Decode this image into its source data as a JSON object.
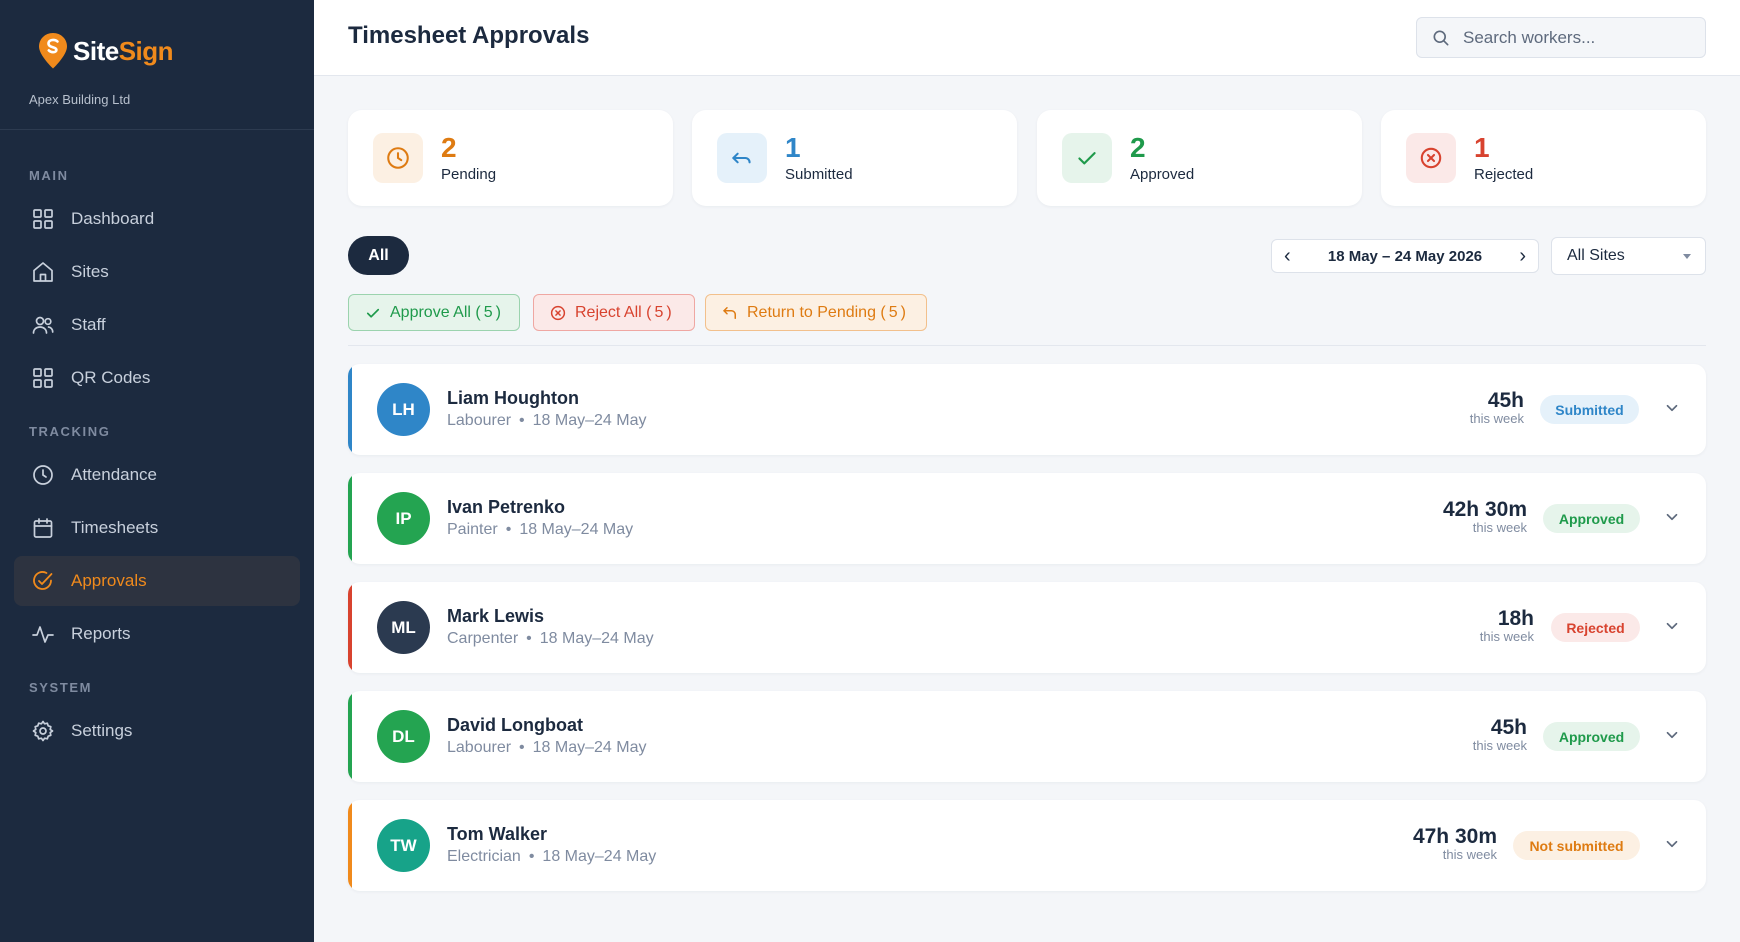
{
  "sidebar": {
    "logo": {
      "word1": "Site",
      "word2": "Sign"
    },
    "company": "Apex Building Ltd",
    "sections": {
      "main": "MAIN",
      "tracking": "TRACKING",
      "system": "SYSTEM"
    },
    "items": [
      {
        "label": "Dashboard",
        "icon": "grid-icon"
      },
      {
        "label": "Sites",
        "icon": "home-icon"
      },
      {
        "label": "Staff",
        "icon": "users-icon"
      },
      {
        "label": "QR Codes",
        "icon": "qr-icon"
      },
      {
        "label": "Attendance",
        "icon": "clock-icon"
      },
      {
        "label": "Timesheets",
        "icon": "calendar-icon"
      },
      {
        "label": "Approvals",
        "icon": "check-circle-icon",
        "active": true
      },
      {
        "label": "Reports",
        "icon": "activity-icon"
      },
      {
        "label": "Settings",
        "icon": "gear-icon"
      }
    ]
  },
  "header": {
    "title": "Timesheet Approvals",
    "search_placeholder": "Search workers..."
  },
  "stats": [
    {
      "value": "2",
      "label": "Pending",
      "color": "#de7b12",
      "icon": "clock-icon"
    },
    {
      "value": "1",
      "label": "Submitted",
      "color": "#2f86c8",
      "icon": "return-icon"
    },
    {
      "value": "2",
      "label": "Approved",
      "color": "#1f9a4b",
      "icon": "check-icon"
    },
    {
      "value": "1",
      "label": "Rejected",
      "color": "#d8432f",
      "icon": "x-circle-icon"
    }
  ],
  "filters": {
    "tab_all": "All",
    "week_range": "18 May – 24 May 2026",
    "site": "All Sites"
  },
  "bulk_actions": {
    "approve_label": "Approve All (",
    "reject_label": "Reject All (",
    "return_label": "Return to Pending (",
    "count": "5",
    "close": ")"
  },
  "workers": [
    {
      "initials": "LH",
      "name": "Liam Houghton",
      "role": "Labourer",
      "period": "18 May–24 May",
      "hours": "45h",
      "hours_note": "this week",
      "status": "Submitted",
      "avatar_color": "#2f86c8",
      "accent": "#2f86c8"
    },
    {
      "initials": "IP",
      "name": "Ivan Petrenko",
      "role": "Painter",
      "period": "18 May–24 May",
      "hours": "42h 30m",
      "hours_note": "this week",
      "status": "Approved",
      "avatar_color": "#24a451",
      "accent": "#24a451"
    },
    {
      "initials": "ML",
      "name": "Mark Lewis",
      "role": "Carpenter",
      "period": "18 May–24 May",
      "hours": "18h",
      "hours_note": "this week",
      "status": "Rejected",
      "avatar_color": "#2b3a50",
      "accent": "#d8432f"
    },
    {
      "initials": "DL",
      "name": "David Longboat",
      "role": "Labourer",
      "period": "18 May–24 May",
      "hours": "45h",
      "hours_note": "this week",
      "status": "Approved",
      "avatar_color": "#24a451",
      "accent": "#24a451"
    },
    {
      "initials": "TW",
      "name": "Tom Walker",
      "role": "Electrician",
      "period": "18 May–24 May",
      "hours": "47h 30m",
      "hours_note": "this week",
      "status": "Not submitted",
      "avatar_color": "#17a389",
      "accent": "#f08a1c"
    }
  ]
}
